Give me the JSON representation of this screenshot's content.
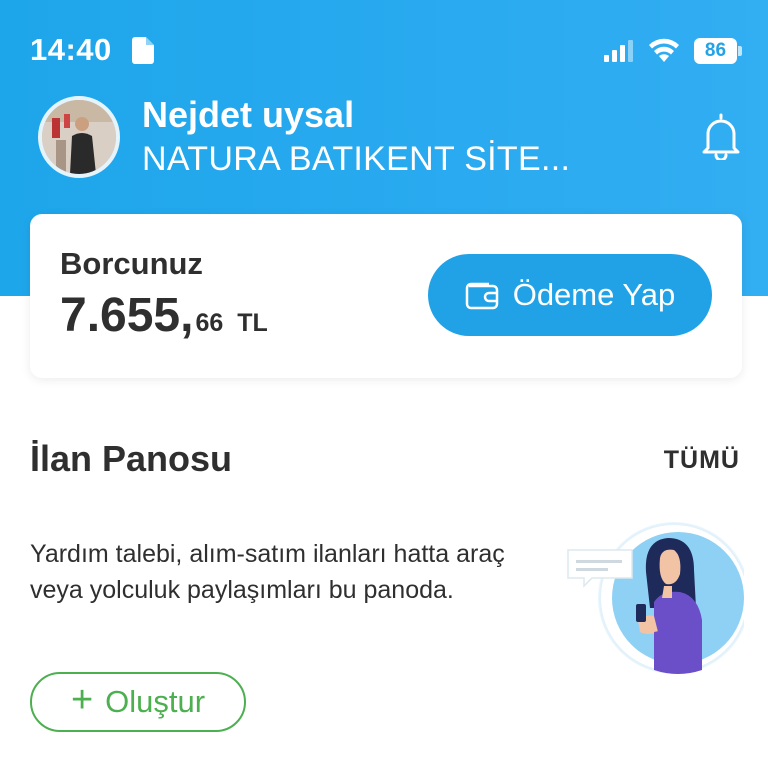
{
  "status_bar": {
    "time": "14:40",
    "battery": "86",
    "icons": [
      "document-icon",
      "signal-icon",
      "wifi-icon",
      "battery-icon"
    ]
  },
  "profile": {
    "name": "Nejdet uysal",
    "site": "NATURA BATIKENT SİTE..."
  },
  "debt": {
    "label": "Borcunuz",
    "amount_main": "7.655,",
    "amount_decimal": "66",
    "currency": "TL",
    "pay_button": "Ödeme Yap"
  },
  "board": {
    "title": "İlan Panosu",
    "see_all": "TÜMÜ",
    "description": "Yardım talebi, alım-satım ilanları hatta araç veya yolculuk paylaşımları bu panoda.",
    "create_button": "Oluştur"
  },
  "colors": {
    "header": "#22a6ec",
    "primary_button": "#22a2e6",
    "create_green": "#4caf50"
  }
}
